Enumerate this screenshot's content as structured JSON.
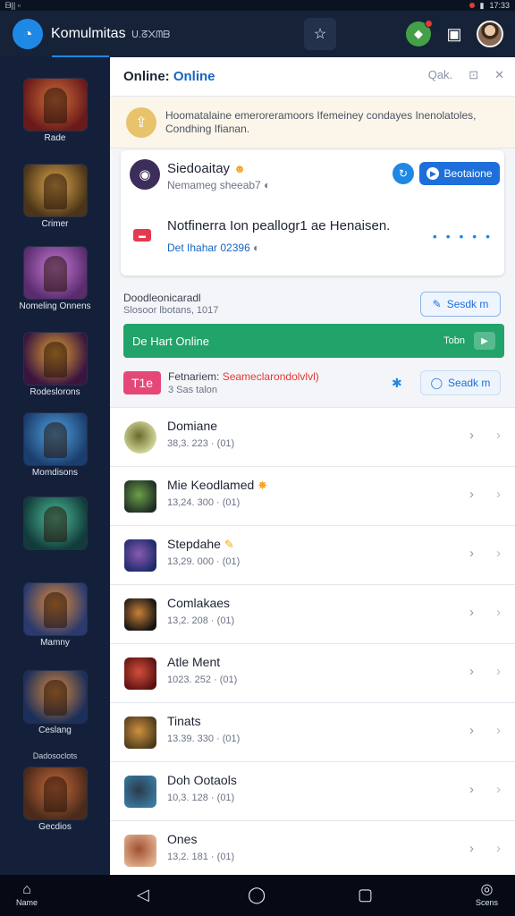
{
  "statusbar": {
    "left": "ᗷ|| ▫",
    "time": "17:33"
  },
  "app": {
    "title": "Komulmitas",
    "subtitle": "ᑌ.ᘔ᙭ᗰᗷ",
    "logo_glyph": "◔"
  },
  "colors": {
    "accent": "#1e88e5",
    "sidebar_bg": "#14203a",
    "green": "#21a36a",
    "badge_pink": "#e54878"
  },
  "sidebar": {
    "items": [
      {
        "label": "Rade",
        "c1": "#6a1a1a",
        "c2": "#d0703a"
      },
      {
        "label": "Crimer",
        "c1": "#4a3518",
        "c2": "#e0a74b"
      },
      {
        "label": "Nomeling Onnens",
        "c1": "#5a2c6e",
        "c2": "#c77ad6"
      },
      {
        "label": "Rodeslorons",
        "c1": "#3a1540",
        "c2": "#e0a030"
      },
      {
        "label": "Momdisons",
        "c1": "#1b3e6e",
        "c2": "#4fa2e0"
      },
      {
        "label": "",
        "c1": "#123b3a",
        "c2": "#4cbf9a"
      },
      {
        "label": "Mamny",
        "c1": "#2a3a6e",
        "c2": "#e08a3a"
      },
      {
        "label": "Ceslang",
        "c1": "#1c2f5a",
        "c2": "#d8883a"
      },
      {
        "label": "Gecdios",
        "c1": "#4a2a1a",
        "c2": "#c86a3a"
      }
    ],
    "extra_label": "Dadosoclots"
  },
  "main": {
    "title_prefix": "Online:",
    "title_accent": "Online",
    "head_icons": [
      "Qak.",
      "⊡",
      "✕"
    ],
    "banner": "Hoomatalaine emeroreramoors Ifemeiney condayes Inenolatoles, Condhing Ifianan.",
    "card": {
      "name": "Siedoaitay",
      "name_emoji": "☻",
      "sub": "Nemameg sheeab7",
      "sub_icon": "◐",
      "refresh_glyph": "↻",
      "button": "Beotaione",
      "message": "Notfinerra Ion peallogr1 ae Henaisen.",
      "date": "Det Ihahar 02396",
      "date_icon": "◐",
      "dots": "• • • • •",
      "tag": "▬"
    },
    "online_label": "Doodleonicaradl",
    "online_sub": "Slosoor lbotans, 1017",
    "search_btn1": "Sesdk m",
    "green_label": "De Hart Online",
    "green_right": "Tobn",
    "highlight_badge": "T1e",
    "highlight_title_prefix": "Fetnariem:",
    "highlight_title_red": "Seameclarondolvlvl)",
    "highlight_sub": "3 Sas talon",
    "search_btn2": "Seadk m",
    "list": [
      {
        "name": "Domiane",
        "meta": "38,3. 223 · (01)",
        "emoji": "",
        "c1": "#dfe3a8",
        "c2": "#6a6a2a",
        "round": true
      },
      {
        "name": "Mie Keodlamed",
        "meta": "13,24. 300 · (01)",
        "emoji": "✸",
        "c1": "#1e2a22",
        "c2": "#6aa04a",
        "round": false
      },
      {
        "name": "Stepdahe",
        "meta": "13,29. 000 · (01)",
        "emoji": "✎",
        "c1": "#1a2a6a",
        "c2": "#8a5ab0",
        "round": false
      },
      {
        "name": "Comlakaes",
        "meta": "13,2. 208 · (01)",
        "emoji": "",
        "c1": "#111111",
        "c2": "#c8803a",
        "round": false
      },
      {
        "name": "Atle Ment",
        "meta": "1023. 252 · (01)",
        "emoji": "",
        "c1": "#5a1010",
        "c2": "#d0503a",
        "round": false
      },
      {
        "name": "Tinats",
        "meta": "13.39. 330 · (01)",
        "emoji": "",
        "c1": "#4a3a1a",
        "c2": "#d09040",
        "round": false
      },
      {
        "name": "Doh Ootaols",
        "meta": "10,3. 128 · (01)",
        "emoji": "",
        "c1": "#3a7aa0",
        "c2": "#2a3a4a",
        "round": false
      },
      {
        "name": "Ones",
        "meta": "13,2. 181 · (01)",
        "emoji": "",
        "c1": "#e0b090",
        "c2": "#a05030",
        "round": false
      }
    ]
  },
  "bottomnav": {
    "home": "Name",
    "right": "Scens"
  }
}
